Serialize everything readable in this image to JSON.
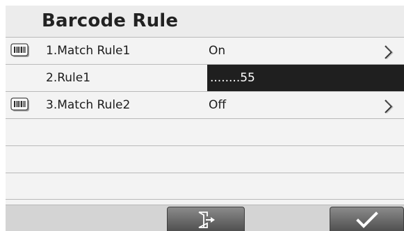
{
  "header": {
    "title": "Barcode Rule"
  },
  "rows": [
    {
      "label": "1.Match Rule1",
      "value": "On",
      "icon": "barcode-icon",
      "has_chevron": true
    },
    {
      "label": "2.Rule1",
      "value": "........55",
      "selected": true
    },
    {
      "label": "3.Match Rule2",
      "value": "Off",
      "icon": "barcode-icon",
      "has_chevron": true
    },
    {
      "label": "",
      "value": ""
    },
    {
      "label": "",
      "value": ""
    },
    {
      "label": "",
      "value": ""
    }
  ],
  "footer": {
    "exit_icon": "exit-icon",
    "confirm_icon": "checkmark-icon"
  },
  "colors": {
    "background": "#f3f3f3",
    "selected_bg": "#1f1f1f",
    "selected_text": "#ffffff",
    "divider": "#b9b9b9",
    "softkey": "#5e5e5e"
  }
}
